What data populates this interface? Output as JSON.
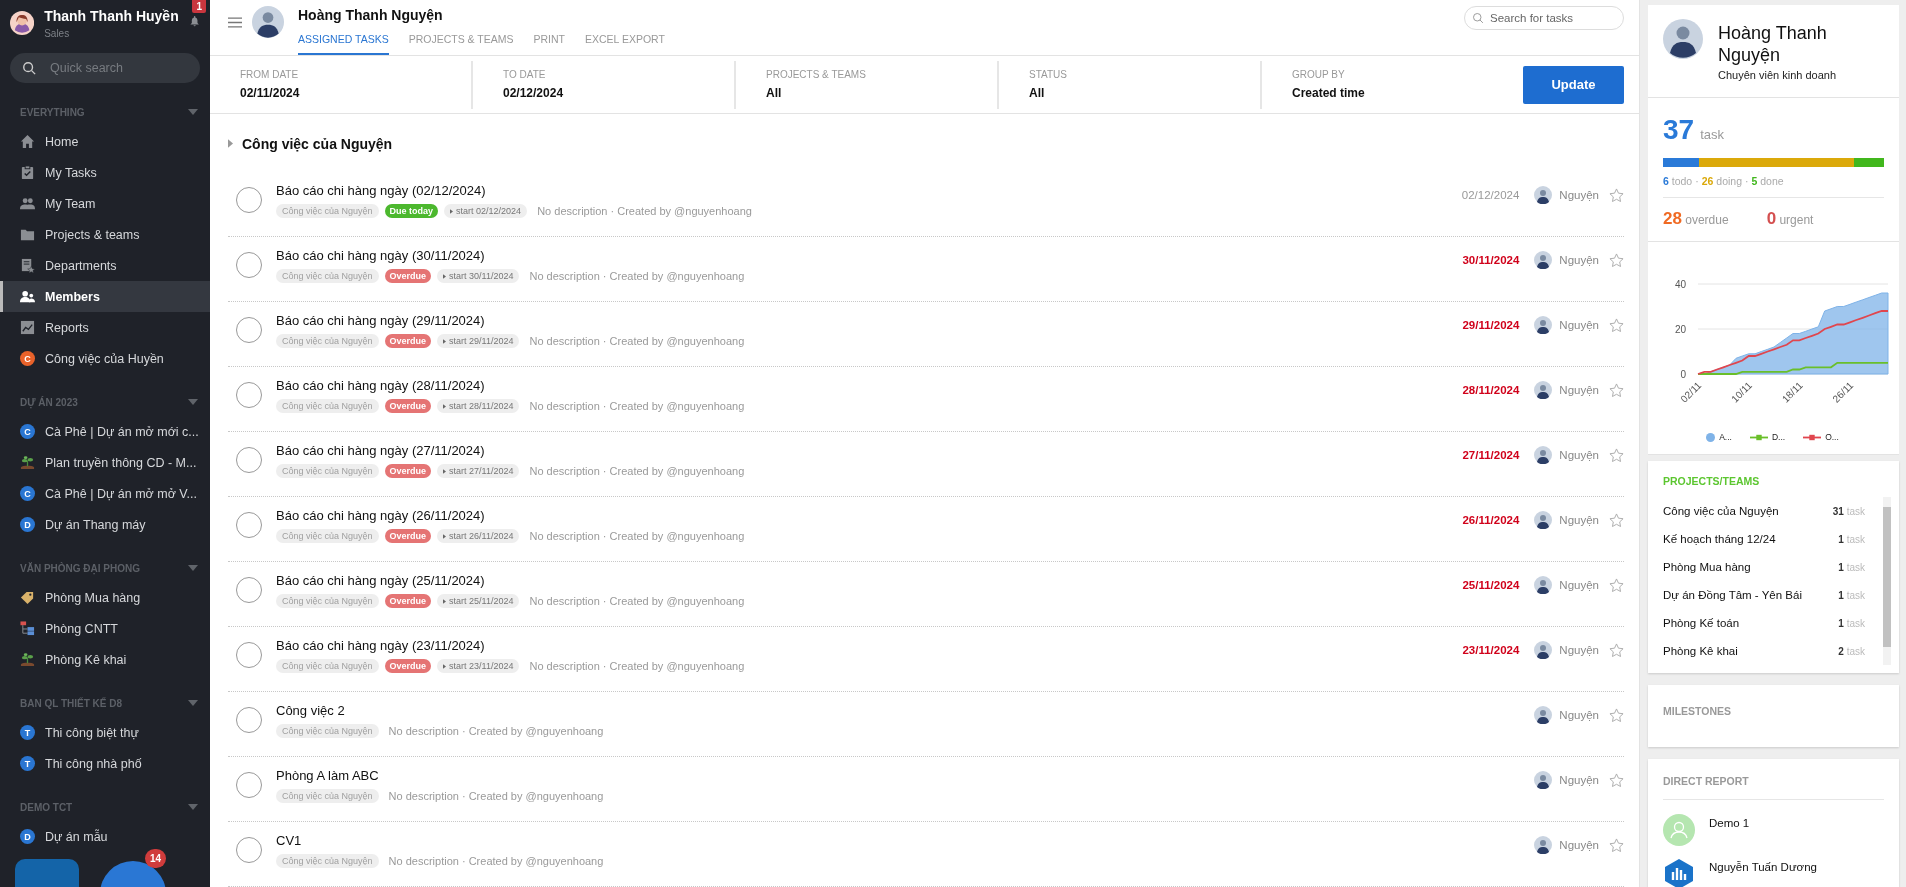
{
  "sidebar": {
    "user": {
      "name": "Thanh Thanh Huyền",
      "role": "Sales",
      "notifications": "1"
    },
    "search": {
      "placeholder": "Quick search"
    },
    "sections": [
      {
        "title": "EVERYTHING",
        "items": [
          {
            "label": "Home",
            "kind": "home",
            "selected": false
          },
          {
            "label": "My Tasks",
            "kind": "tasks",
            "selected": false
          },
          {
            "label": "My Team",
            "kind": "team",
            "selected": false
          },
          {
            "label": "Projects & teams",
            "kind": "folder",
            "selected": false
          },
          {
            "label": "Departments",
            "kind": "departments",
            "selected": false
          },
          {
            "label": "Members",
            "kind": "members",
            "selected": true
          },
          {
            "label": "Reports",
            "kind": "reports",
            "selected": false
          },
          {
            "label": "Công việc của Huyền",
            "kind": "letter",
            "letter": "C",
            "color": "#e8622a",
            "selected": false
          }
        ]
      },
      {
        "title": "DỰ ÁN 2023",
        "items": [
          {
            "label": "Cà Phê | Dự án mở mới c...",
            "kind": "letter",
            "letter": "C",
            "color": "#2a76d2",
            "selected": false
          },
          {
            "label": "Plan truyền thông CD - M...",
            "kind": "plant",
            "selected": false
          },
          {
            "label": "Cà Phê | Dự án mở mở V...",
            "kind": "letter",
            "letter": "C",
            "color": "#2a76d2",
            "selected": false
          },
          {
            "label": "Dự án Thang máy",
            "kind": "letter",
            "letter": "D",
            "color": "#2a76d2",
            "selected": false
          }
        ]
      },
      {
        "title": "VĂN PHÒNG ĐẠI PHONG",
        "items": [
          {
            "label": "Phòng Mua hàng",
            "kind": "tag",
            "selected": false
          },
          {
            "label": "Phòng CNTT",
            "kind": "org",
            "selected": false
          },
          {
            "label": "Phòng Kê khai",
            "kind": "plant",
            "selected": false
          }
        ]
      },
      {
        "title": "BAN QL THIẾT KẾ D8",
        "items": [
          {
            "label": "Thi công biệt thự",
            "kind": "letter",
            "letter": "T",
            "color": "#2a76d2",
            "selected": false
          },
          {
            "label": "Thi công nhà phố",
            "kind": "letter",
            "letter": "T",
            "color": "#2a76d2",
            "selected": false
          }
        ]
      },
      {
        "title": "DEMO TCT",
        "items": [
          {
            "label": "Dự án mẫu",
            "kind": "letter",
            "letter": "D",
            "color": "#2a76d2",
            "selected": false
          }
        ]
      }
    ],
    "fab_badge": "14"
  },
  "header": {
    "name": "Hoàng Thanh Nguyện",
    "search": {
      "placeholder": "Search for tasks"
    },
    "tabs": [
      {
        "label": "ASSIGNED TASKS",
        "selected": true
      },
      {
        "label": "PROJECTS & TEAMS",
        "selected": false
      },
      {
        "label": "PRINT",
        "selected": false
      },
      {
        "label": "EXCEL EXPORT",
        "selected": false
      }
    ]
  },
  "filters": [
    {
      "label": "FROM DATE",
      "value": "02/11/2024"
    },
    {
      "label": "TO DATE",
      "value": "02/12/2024"
    },
    {
      "label": "PROJECTS & TEAMS",
      "value": "All"
    },
    {
      "label": "STATUS",
      "value": "All"
    },
    {
      "label": "GROUP BY",
      "value": "Created time"
    }
  ],
  "update_button": "Update",
  "group": {
    "title": "Công việc của Nguyện",
    "expanded": false,
    "tasks": [
      {
        "title": "Báo cáo chi hàng ngày (02/12/2024)",
        "done": false,
        "project": "Công việc của Nguyện",
        "status": {
          "kind": "due_today",
          "label": "Due today"
        },
        "start": "start 02/12/2024",
        "description": "No description · Created by @nguyenhoang",
        "due": "02/12/2024",
        "assignee": "Nguyện",
        "starred": false
      },
      {
        "title": "Báo cáo chi hàng ngày (30/11/2024)",
        "done": false,
        "project": "Công việc của Nguyện",
        "status": {
          "kind": "overdue",
          "label": "Overdue"
        },
        "start": "start 30/11/2024",
        "description": "No description · Created by @nguyenhoang",
        "due": "30/11/2024",
        "assignee": "Nguyện",
        "starred": false
      },
      {
        "title": "Báo cáo chi hàng ngày (29/11/2024)",
        "done": false,
        "project": "Công việc của Nguyện",
        "status": {
          "kind": "overdue",
          "label": "Overdue"
        },
        "start": "start 29/11/2024",
        "description": "No description · Created by @nguyenhoang",
        "due": "29/11/2024",
        "assignee": "Nguyện",
        "starred": false
      },
      {
        "title": "Báo cáo chi hàng ngày (28/11/2024)",
        "done": false,
        "project": "Công việc của Nguyện",
        "status": {
          "kind": "overdue",
          "label": "Overdue"
        },
        "start": "start 28/11/2024",
        "description": "No description · Created by @nguyenhoang",
        "due": "28/11/2024",
        "assignee": "Nguyện",
        "starred": false
      },
      {
        "title": "Báo cáo chi hàng ngày (27/11/2024)",
        "done": false,
        "project": "Công việc của Nguyện",
        "status": {
          "kind": "overdue",
          "label": "Overdue"
        },
        "start": "start 27/11/2024",
        "description": "No description · Created by @nguyenhoang",
        "due": "27/11/2024",
        "assignee": "Nguyện",
        "starred": false
      },
      {
        "title": "Báo cáo chi hàng ngày (26/11/2024)",
        "done": false,
        "project": "Công việc của Nguyện",
        "status": {
          "kind": "overdue",
          "label": "Overdue"
        },
        "start": "start 26/11/2024",
        "description": "No description · Created by @nguyenhoang",
        "due": "26/11/2024",
        "assignee": "Nguyện",
        "starred": false
      },
      {
        "title": "Báo cáo chi hàng ngày (25/11/2024)",
        "done": false,
        "project": "Công việc của Nguyện",
        "status": {
          "kind": "overdue",
          "label": "Overdue"
        },
        "start": "start 25/11/2024",
        "description": "No description · Created by @nguyenhoang",
        "due": "25/11/2024",
        "assignee": "Nguyện",
        "starred": false
      },
      {
        "title": "Báo cáo chi hàng ngày (23/11/2024)",
        "done": false,
        "project": "Công việc của Nguyện",
        "status": {
          "kind": "overdue",
          "label": "Overdue"
        },
        "start": "start 23/11/2024",
        "description": "No description · Created by @nguyenhoang",
        "due": "23/11/2024",
        "assignee": "Nguyện",
        "starred": false
      },
      {
        "title": "Công việc 2",
        "done": false,
        "project": "Công việc của Nguyện",
        "description": "No description · Created by @nguyenhoang",
        "assignee": "Nguyện",
        "starred": false
      },
      {
        "title": "Phòng A làm ABC",
        "done": false,
        "project": "Công việc của Nguyện",
        "description": "No description · Created by @nguyenhoang",
        "assignee": "Nguyện",
        "starred": false
      },
      {
        "title": "CV1",
        "done": false,
        "project": "Công việc của Nguyện",
        "description": "No description · Created by @nguyenhoang",
        "assignee": "Nguyện",
        "starred": false
      }
    ]
  },
  "profile": {
    "name": "Hoàng Thanh Nguyện",
    "role": "Chuyên viên kinh doanh"
  },
  "stats": {
    "total": "37",
    "total_unit": "task",
    "segments": [
      {
        "count": "6",
        "label": "todo",
        "color": "#2a7ad8"
      },
      {
        "count": "26",
        "label": "doing",
        "color": "#dba90a"
      },
      {
        "count": "5",
        "label": "done",
        "color": "#41b71d"
      }
    ],
    "separator": "·",
    "overdue": {
      "count": "28",
      "label": "overdue"
    },
    "urgent": {
      "count": "0",
      "label": "urgent"
    }
  },
  "chart_data": {
    "type": "line",
    "categories": [
      "02/11",
      null,
      null,
      null,
      null,
      null,
      null,
      null,
      "10/11",
      null,
      null,
      null,
      null,
      null,
      null,
      null,
      "18/11",
      null,
      null,
      null,
      null,
      null,
      null,
      null,
      "26/11",
      null,
      null,
      null,
      null,
      null,
      null
    ],
    "yticks": [
      0,
      20,
      40
    ],
    "ylim": [
      0,
      40
    ],
    "legend": "bottom",
    "series": [
      {
        "name": "A...",
        "type": "area",
        "color": "#7fb3e8",
        "values": [
          0,
          0,
          1,
          2,
          3,
          4,
          7,
          8,
          9,
          9,
          10,
          11,
          12,
          14,
          16,
          18,
          18,
          19,
          20,
          21,
          28,
          29,
          30,
          30,
          31,
          32,
          33,
          34,
          35,
          36,
          36
        ]
      },
      {
        "name": "D...",
        "type": "line",
        "color": "#6abf2a",
        "values": [
          0,
          0,
          0,
          0,
          0,
          0,
          0,
          1,
          1,
          1,
          1,
          1,
          1,
          1,
          1,
          2,
          2,
          3,
          3,
          3,
          3,
          3,
          5,
          5,
          5,
          5,
          5,
          5,
          5,
          5,
          5
        ]
      },
      {
        "name": "O...",
        "type": "line",
        "color": "#e0464e",
        "values": [
          0,
          1,
          1,
          2,
          3,
          4,
          5,
          6,
          8,
          8,
          9,
          10,
          11,
          12,
          13,
          15,
          15,
          16,
          17,
          18,
          20,
          21,
          22,
          22,
          23,
          24,
          25,
          26,
          27,
          28,
          28
        ]
      }
    ]
  },
  "projects": {
    "title": "PROJECTS/TEAMS",
    "items": [
      {
        "name": "Công việc của Nguyện",
        "count": "31",
        "unit": "task"
      },
      {
        "name": "Kế hoạch tháng 12/24",
        "count": "1",
        "unit": "task"
      },
      {
        "name": "Phòng Mua hàng",
        "count": "1",
        "unit": "task"
      },
      {
        "name": "Dự án Đồng Tâm - Yên Bái",
        "count": "1",
        "unit": "task"
      },
      {
        "name": "Phòng Kế toán",
        "count": "1",
        "unit": "task"
      },
      {
        "name": "Phòng Kê khai",
        "count": "2",
        "unit": "task"
      }
    ]
  },
  "milestones": {
    "title": "MILESTONES"
  },
  "direct_report": {
    "title": "DIRECT REPORT",
    "people": [
      {
        "name": "Demo 1",
        "kind": "placeholder"
      },
      {
        "name": "Nguyễn Tuấn Dương",
        "kind": "logo"
      }
    ]
  }
}
